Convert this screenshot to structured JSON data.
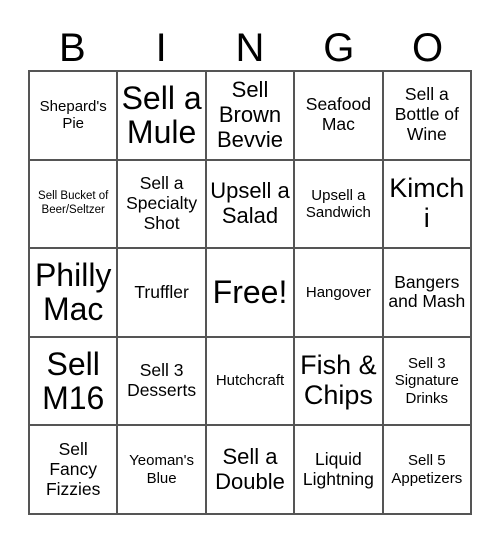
{
  "card": {
    "title": "BINGO",
    "header_letters": [
      "B",
      "I",
      "N",
      "G",
      "O"
    ],
    "columns": 5,
    "rows": 5,
    "free_space_label": "Free!",
    "free_space_index": 12,
    "colors": {
      "background": "#ffffff",
      "cell_background": "#ffffff",
      "border": "#555555",
      "text": "#000000"
    },
    "cells": [
      {
        "text": "Shepard's Pie",
        "size": "sm",
        "row": 1,
        "col": "B"
      },
      {
        "text": "Sell a Mule",
        "size": "xxl",
        "row": 1,
        "col": "I"
      },
      {
        "text": "Sell Brown Bevvie",
        "size": "lg",
        "row": 1,
        "col": "N"
      },
      {
        "text": "Seafood Mac",
        "size": "md",
        "row": 1,
        "col": "G"
      },
      {
        "text": "Sell a Bottle of Wine",
        "size": "md",
        "row": 1,
        "col": "O"
      },
      {
        "text": "Sell Bucket of Beer/Seltzer",
        "size": "xs",
        "row": 2,
        "col": "B"
      },
      {
        "text": "Sell a Specialty Shot",
        "size": "md",
        "row": 2,
        "col": "I"
      },
      {
        "text": "Upsell a Salad",
        "size": "lg",
        "row": 2,
        "col": "N"
      },
      {
        "text": "Upsell a Sandwich",
        "size": "sm",
        "row": 2,
        "col": "G"
      },
      {
        "text": "Kimchi",
        "size": "xl",
        "row": 2,
        "col": "O"
      },
      {
        "text": "Philly Mac",
        "size": "xxl",
        "row": 3,
        "col": "B"
      },
      {
        "text": "Truffler",
        "size": "md",
        "row": 3,
        "col": "I"
      },
      {
        "text": "Free!",
        "size": "xxl",
        "row": 3,
        "col": "N"
      },
      {
        "text": "Hangover",
        "size": "sm",
        "row": 3,
        "col": "G"
      },
      {
        "text": "Bangers and Mash",
        "size": "md",
        "row": 3,
        "col": "O"
      },
      {
        "text": "Sell M16",
        "size": "xxl",
        "row": 4,
        "col": "B"
      },
      {
        "text": "Sell 3 Desserts",
        "size": "md",
        "row": 4,
        "col": "I"
      },
      {
        "text": "Hutchcraft",
        "size": "sm",
        "row": 4,
        "col": "N"
      },
      {
        "text": "Fish & Chips",
        "size": "xl",
        "row": 4,
        "col": "G"
      },
      {
        "text": "Sell 3 Signature Drinks",
        "size": "sm",
        "row": 4,
        "col": "O"
      },
      {
        "text": "Sell Fancy Fizzies",
        "size": "md",
        "row": 5,
        "col": "B"
      },
      {
        "text": "Yeoman's Blue",
        "size": "sm",
        "row": 5,
        "col": "I"
      },
      {
        "text": "Sell a Double",
        "size": "lg",
        "row": 5,
        "col": "N"
      },
      {
        "text": "Liquid Lightning",
        "size": "md",
        "row": 5,
        "col": "G"
      },
      {
        "text": "Sell 5 Appetizers",
        "size": "sm",
        "row": 5,
        "col": "O"
      }
    ]
  }
}
